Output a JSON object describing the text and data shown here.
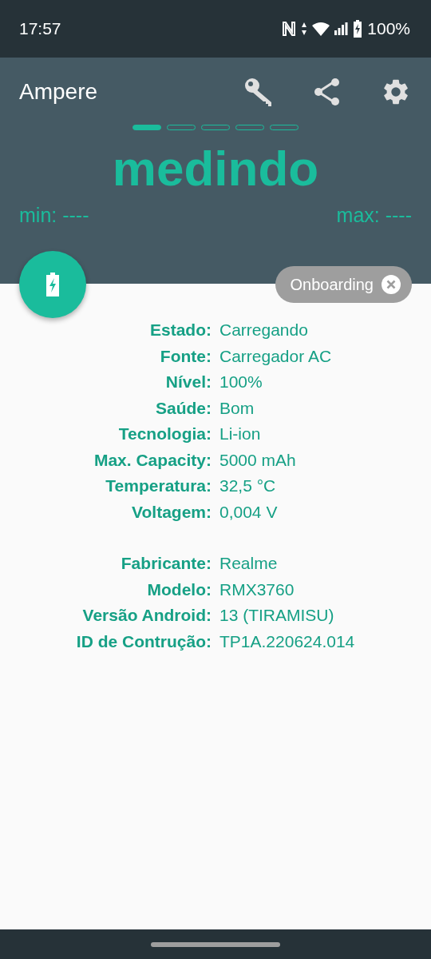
{
  "status_bar": {
    "time": "17:57",
    "battery": "100%"
  },
  "app_bar": {
    "title": "Ampere"
  },
  "pager": [
    {
      "selected": true
    },
    {
      "selected": false
    },
    {
      "selected": false
    },
    {
      "selected": false
    },
    {
      "selected": false
    }
  ],
  "reading": "medindo",
  "min": "min: ----",
  "max": "max: ----",
  "chip": {
    "label": "Onboarding"
  },
  "info_groups": [
    [
      {
        "label": "Estado:",
        "value": "Carregando"
      },
      {
        "label": "Fonte:",
        "value": "Carregador AC"
      },
      {
        "label": "Nível:",
        "value": "100%"
      },
      {
        "label": "Saúde:",
        "value": "Bom"
      },
      {
        "label": "Tecnologia:",
        "value": "Li-ion"
      },
      {
        "label": "Max. Capacity:",
        "value": "5000 mAh"
      },
      {
        "label": "Temperatura:",
        "value": "32,5 °C"
      },
      {
        "label": "Voltagem:",
        "value": "0,004 V"
      }
    ],
    [
      {
        "label": "Fabricante:",
        "value": "Realme"
      },
      {
        "label": "Modelo:",
        "value": "RMX3760"
      },
      {
        "label": "Versão Android:",
        "value": "13 (TIRAMISU)"
      },
      {
        "label": "ID de Contrução:",
        "value": "TP1A.220624.014"
      }
    ]
  ]
}
